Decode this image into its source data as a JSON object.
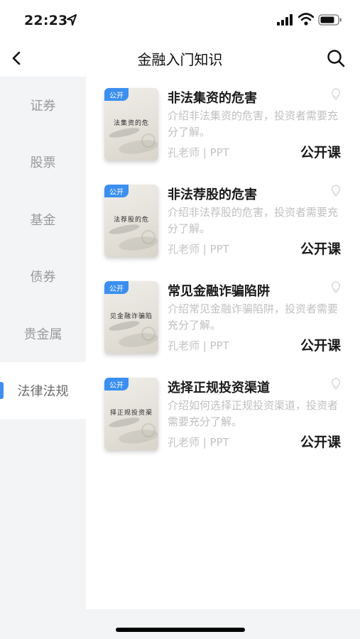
{
  "status_bar": {
    "time": "22:23",
    "icons": [
      "location-arrow-icon",
      "cellular-signal-icon",
      "wifi-icon",
      "battery-icon"
    ]
  },
  "nav": {
    "title": "金融入门知识",
    "back_icon": "chevron-left-icon",
    "search_icon": "search-icon"
  },
  "sidebar": {
    "items": [
      {
        "label": "证券"
      },
      {
        "label": "股票"
      },
      {
        "label": "基金"
      },
      {
        "label": "债券"
      },
      {
        "label": "贵金属"
      },
      {
        "label": "法律法规",
        "active": true
      }
    ],
    "accent_color": "#3f8ef0"
  },
  "courses": [
    {
      "badge": "公开",
      "cover_text": "法集资的危",
      "title": "非法集资的危害",
      "description": "介绍非法集资的危害，投资者需要充分了解。",
      "meta": "孔老师 | PPT",
      "type": "公开课"
    },
    {
      "badge": "公开",
      "cover_text": "法荐股的危",
      "title": "非法荐股的危害",
      "description": "介绍非法荐股的危害，投资者需要充分了解。",
      "meta": "孔老师 | PPT",
      "type": "公开课"
    },
    {
      "badge": "公开",
      "cover_text": "见金融诈骗陷",
      "title": "常见金融诈骗陷阱",
      "description": "介绍常见金融诈骗陷阱，投资者需要充分了解。",
      "meta": "孔老师 | PPT",
      "type": "公开课"
    },
    {
      "badge": "公开",
      "cover_text": "择正规投资渠",
      "title": "选择正规投资渠道",
      "description": "介绍如何选择正规投资渠道，投资者需要充分了解。",
      "meta": "孔老师 | PPT",
      "type": "公开课"
    }
  ],
  "colors": {
    "badge": "#3b8ff0",
    "sidebar_bg": "#f3f4f6",
    "muted_text": "#c0c0c0"
  }
}
